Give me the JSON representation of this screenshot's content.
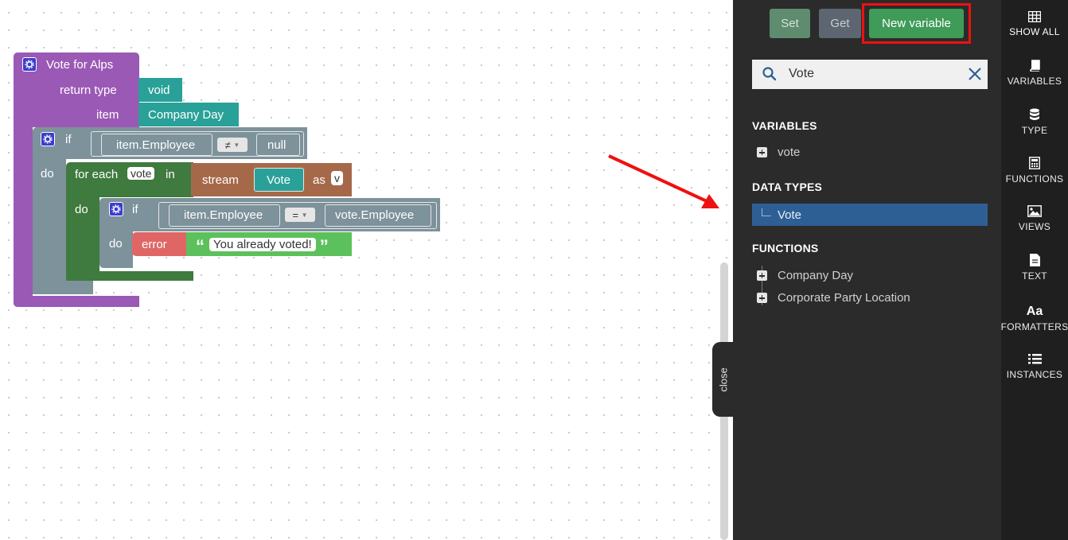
{
  "blocks": {
    "function": {
      "title": "Vote for Alps",
      "return_type_label": "return type",
      "return_type_value": "void",
      "item_label": "item",
      "item_value": "Company Day"
    },
    "if1": {
      "if_label": "if",
      "do_label": "do",
      "left": "item.Employee",
      "op": "≠",
      "right": "null"
    },
    "foreach": {
      "label": "for each",
      "var": "vote",
      "in_label": "in",
      "stream_label": "stream",
      "stream_type": "Vote",
      "as_label": "as",
      "as_value": "v",
      "do_label": "do"
    },
    "if2": {
      "if_label": "if",
      "do_label": "do",
      "left": "item.Employee",
      "op": "=",
      "right": "vote.Employee"
    },
    "error": {
      "label": "error",
      "open_quote": "“",
      "message": "You already voted!",
      "close_quote": "”"
    }
  },
  "close_tab": {
    "label": "close"
  },
  "toolbar": {
    "set_label": "Set",
    "get_label": "Get",
    "new_variable_label": "New variable"
  },
  "search": {
    "value": "Vote",
    "icon": "search-icon",
    "clear_icon": "close-icon"
  },
  "sections": {
    "variables": {
      "heading": "VARIABLES",
      "items": [
        "vote"
      ]
    },
    "data_types": {
      "heading": "DATA TYPES",
      "items": [
        "Vote"
      ]
    },
    "functions": {
      "heading": "FUNCTIONS",
      "items": [
        "Company Day",
        "Corporate Party Location"
      ]
    }
  },
  "rail": [
    {
      "label": "SHOW ALL",
      "icon": "table-icon"
    },
    {
      "label": "VARIABLES",
      "icon": "book-icon"
    },
    {
      "label": "TYPE",
      "icon": "database-icon"
    },
    {
      "label": "FUNCTIONS",
      "icon": "calculator-icon"
    },
    {
      "label": "VIEWS",
      "icon": "image-icon"
    },
    {
      "label": "TEXT",
      "icon": "document-icon"
    },
    {
      "label": "FORMATTERS",
      "icon": "font-icon",
      "glyph": "Aa"
    },
    {
      "label": "INSTANCES",
      "icon": "list-icon"
    }
  ],
  "colors": {
    "function_block": "#9b59b6",
    "if_block": "#7d929b",
    "loop_block": "#3f7a3f",
    "type_value": "#2aa198",
    "stream_block": "#a5694a",
    "error_block": "#e06666",
    "string_block": "#5cc15c",
    "panel": "#2b2b2b",
    "rail": "#1f1f1f",
    "selected": "#2e5f94",
    "annotation": "#ee1111"
  }
}
